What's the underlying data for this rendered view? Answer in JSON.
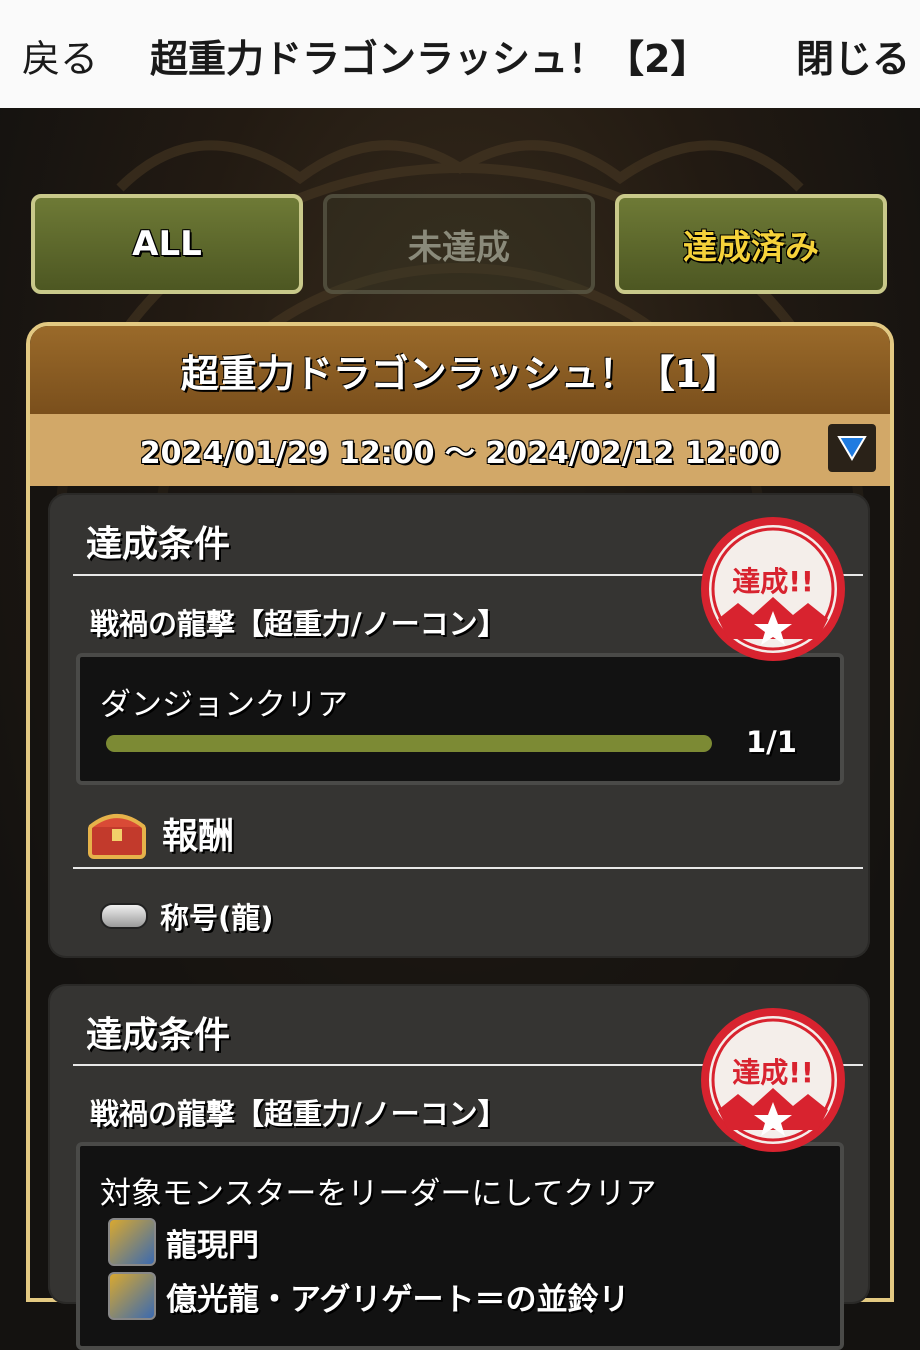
{
  "topbar": {
    "back_label": "戻る",
    "title": "超重力ドラゴンラッシュ！【2】",
    "close_label": "閉じる"
  },
  "tabs": [
    {
      "label": "ALL",
      "state": "active"
    },
    {
      "label": "未達成",
      "state": "disabled"
    },
    {
      "label": "達成済み",
      "state": "normal"
    }
  ],
  "panel": {
    "title": "超重力ドラゴンラッシュ！【1】",
    "date_range": "2024/01/29 12:00 ～ 2024/02/12 12:00"
  },
  "cards": [
    {
      "heading": "達成条件",
      "dungeon": "戦禍の龍撃【超重力/ノーコン】",
      "condition": "ダンジョンクリア",
      "progress": {
        "current": 1,
        "total": 1,
        "text": "1/1",
        "fraction": 1.0
      },
      "reward_heading": "報酬",
      "reward_item": "称号(龍)",
      "stamp_text": "達成!!"
    },
    {
      "heading": "達成条件",
      "dungeon": "戦禍の龍撃【超重力/ノーコン】",
      "condition": "対象モンスターをリーダーにしてクリア",
      "monsters": [
        "龍現門",
        "億光龍・アグリゲート＝の並鈴リ"
      ],
      "stamp_text": "達成!!"
    }
  ],
  "colors": {
    "accent_green": "#6e7a36",
    "done_yellow": "#f5d23a",
    "panel_brown": "#9a6a2a",
    "stamp_red": "#d8232f"
  }
}
